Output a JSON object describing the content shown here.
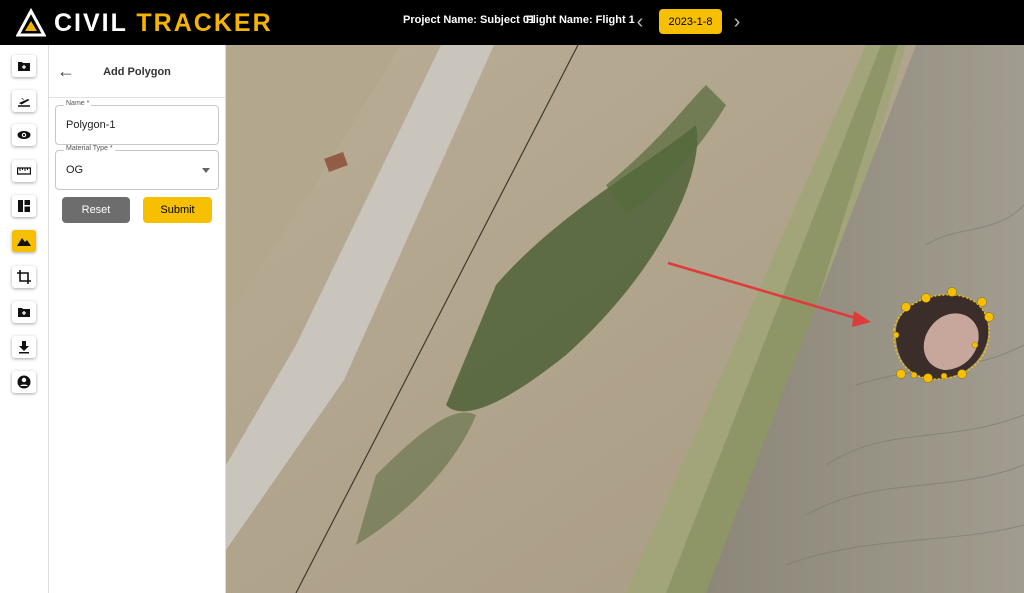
{
  "header": {
    "logo_primary": "CIVIL",
    "logo_accent": "TRACKER",
    "project_label": "Project Name: Subject 01",
    "flight_label": "Flight Name: Flight 1",
    "date": "2023-1-8",
    "accent_color": "#f6c000"
  },
  "rail": {
    "items": [
      {
        "icon": "add-folder-icon"
      },
      {
        "icon": "flight-icon"
      },
      {
        "icon": "eye-icon"
      },
      {
        "icon": "ruler-icon"
      },
      {
        "icon": "dashboard-icon"
      },
      {
        "icon": "terrain-icon",
        "active": true
      },
      {
        "icon": "crop-icon"
      },
      {
        "icon": "add-folder-icon"
      },
      {
        "icon": "download-icon"
      },
      {
        "icon": "account-icon"
      }
    ]
  },
  "panel": {
    "title": "Add Polygon",
    "name_label": "Name *",
    "name_value": "Polygon-1",
    "material_label": "Material Type *",
    "material_value": "OG",
    "reset_label": "Reset",
    "submit_label": "Submit"
  }
}
